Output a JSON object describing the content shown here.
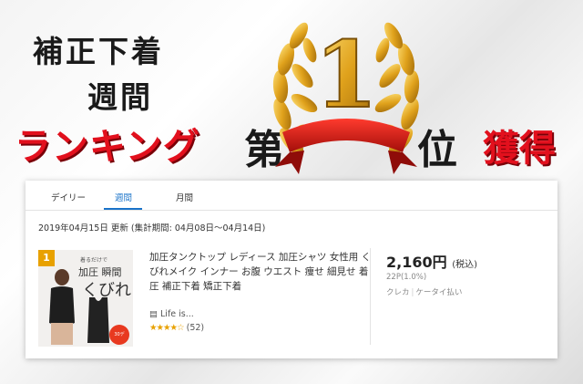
{
  "hero": {
    "line1": "補正下着",
    "line2": "週間",
    "line3": "ランキング",
    "line4_char": "第",
    "rank_number": "1",
    "line4_suffix": "位",
    "line4_tail": "獲得"
  },
  "colors": {
    "accent_red": "#e2101d",
    "gold": "#e8a100",
    "tab_active": "#1a73c9"
  },
  "tabs": [
    "デイリー",
    "週間",
    "月間"
  ],
  "active_tab": "週間",
  "update_text": "2019年04月15日 更新 (集計期間: 04月08日〜04月14日)",
  "item": {
    "rank": "1",
    "thumb_text1": "着るだけで",
    "thumb_text2": "加圧 瞬間",
    "thumb_text3": "くびれ",
    "thumb_badge": "30デ",
    "title": "加圧タンクトップ レディース 加圧シャツ 女性用 くびれメイク インナー お腹 ウエスト 痩せ 細見せ 着圧 補正下着 矯正下着",
    "seller_icon": "store-icon",
    "seller": "Life is...",
    "rating_stars": 4,
    "review_count": "(52)",
    "price": "2,160円",
    "price_note": "(税込)",
    "points": "22P(1.0%)",
    "payment1": "クレカ",
    "payment2": "ケータイ払い"
  }
}
